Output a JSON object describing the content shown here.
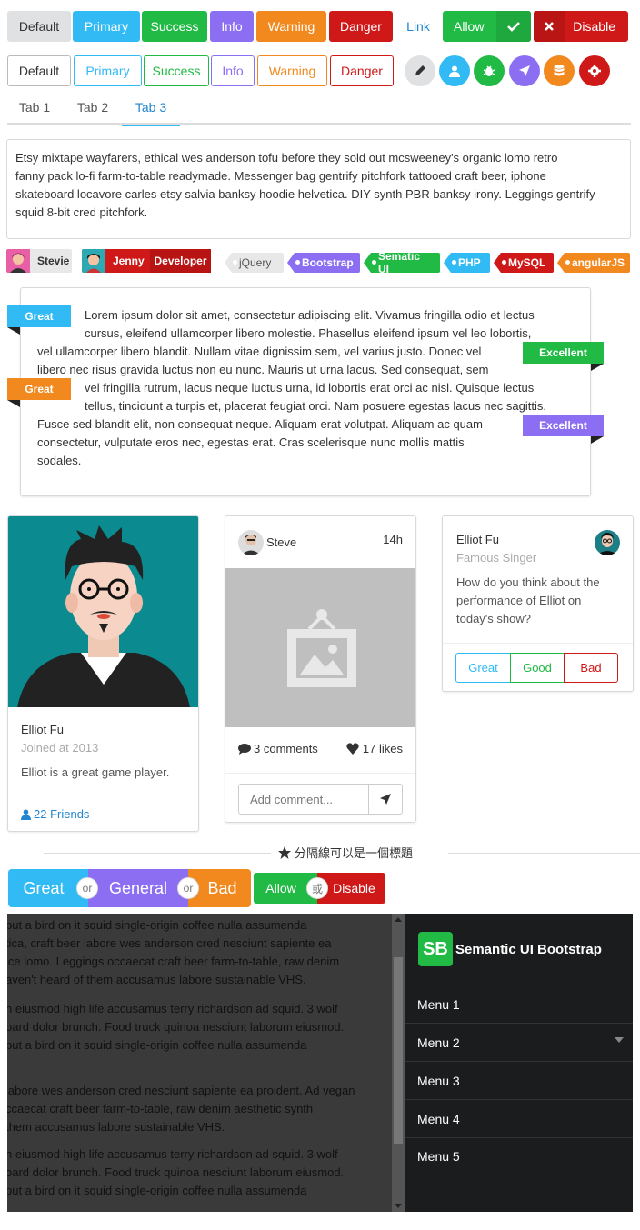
{
  "buttons_row1": {
    "default": "Default",
    "primary": "Primary",
    "success": "Success",
    "info": "Info",
    "warning": "Warning",
    "danger": "Danger",
    "link": "Link",
    "allow": "Allow",
    "disable": "Disable"
  },
  "buttons_row2": {
    "default": "Default",
    "primary": "Primary",
    "success": "Success",
    "info": "Info",
    "warning": "Warning",
    "danger": "Danger",
    "icons": [
      "pencil-icon",
      "user-icon",
      "bug-icon",
      "plane-icon",
      "database-icon",
      "gear-icon"
    ]
  },
  "tabs": [
    "Tab 1",
    "Tab 2",
    "Tab 3"
  ],
  "active_tab": "Tab 3",
  "panel_text": [
    "Etsy mixtape wayfarers, ethical wes anderson tofu before they sold out mcsweeney's organic lomo retro",
    "fanny pack lo-fi farm-to-table readymade. Messenger bag gentrify pitchfork tattooed craft beer, iphone",
    "skateboard locavore carles etsy salvia banksy hoodie helvetica. DIY synth PBR banksy irony. Leggings gentrify",
    "squid 8-bit cred pitchfork."
  ],
  "image_labels": {
    "stevie": "Stevie",
    "jenny": "Jenny",
    "jenny_detail": "Developer"
  },
  "tags": [
    "jQuery",
    "Bootstrap",
    "Sematic UI",
    "PHP",
    "MySQL",
    "angularJS"
  ],
  "ribbons": {
    "great": "Great",
    "excellent": "Excellent"
  },
  "quote_lines": [
    "Lorem ipsum dolor sit amet, consectetur adipiscing elit. Vivamus fringilla odio et lectus",
    "cursus, eleifend ullamcorper libero molestie. Phasellus eleifend ipsum vel leo lobortis,",
    "vel ullamcorper libero blandit. Nullam vitae dignissim sem, vel varius justo. Donec vel",
    "libero nec risus gravida luctus non eu nunc. Mauris ut urna lacus. Sed consequat, sem",
    "vel fringilla rutrum, lacus neque luctus urna, id lobortis erat orci ac nisl. Quisque lectus",
    "tellus, tincidunt a turpis et, placerat feugiat orci. Nam posuere egestas lacus nec sagittis.",
    "Fusce sed blandit elit, non consequat neque. Aliquam erat volutpat. Aliquam ac quam",
    "consectetur, vulputate eros nec, egestas erat. Cras scelerisque nunc mollis mattis",
    "sodales."
  ],
  "profile_card": {
    "name": "Elliot Fu",
    "meta": "Joined at 2013",
    "description": "Elliot is a great game player.",
    "friends": "22 Friends"
  },
  "post_card": {
    "author": "Steve",
    "time": "14h",
    "comments": "3 comments",
    "likes": "17 likes",
    "comment_placeholder": "Add comment..."
  },
  "question_card": {
    "name": "Elliot Fu",
    "meta": "Famous Singer",
    "question": [
      "How do you think about the",
      "performance of Elliot on",
      "today's show?"
    ],
    "great": "Great",
    "good": "Good",
    "bad": "Bad"
  },
  "divider_title": "分隔線可以是一個標題",
  "big_buttons": {
    "great": "Great",
    "or": "or",
    "general": "General",
    "bad": "Bad"
  },
  "small_buttons": {
    "allow": "Allow",
    "or": "或",
    "disable": "Disable"
  },
  "scroll_text": [
    "put a bird on it squid single-origin coffee nulla assumenda",
    "tica, craft beer labore wes anderson cred nesciunt sapiente ea",
    "ice lomo. Leggings occaecat craft beer farm-to-table, raw denim",
    "aven't heard of them accusamus labore sustainable VHS.",
    "",
    "n eiusmod high life accusamus terry richardson ad squid. 3 wolf",
    "oard dolor brunch. Food truck quinoa nesciunt laborum eiusmod.",
    "put a bird on it squid single-origin coffee nulla assumenda",
    "",
    "labore wes anderson cred nesciunt sapiente ea proident. Ad vegan",
    "ccaecat craft beer farm-to-table, raw denim aesthetic synth",
    "them accusamus labore sustainable VHS.",
    "",
    "n eiusmod high life accusamus terry richardson ad squid. 3 wolf",
    "oard dolor brunch. Food truck quinoa nesciunt laborum eiusmod.",
    "put a bird on it squid single-origin coffee nulla assumenda"
  ],
  "sidebar": {
    "logo": "SB",
    "title": "Semantic UI Bootstrap",
    "items": [
      "Menu 1",
      "Menu 2",
      "Menu 3",
      "Menu 4",
      "Menu 5"
    ]
  },
  "colors": {
    "default": "#e0e1e2",
    "primary": "#31baf3",
    "success": "#21ba45",
    "info": "#8c6ef2",
    "warning": "#f2891f",
    "danger": "#cf1818",
    "link": "#2185d0",
    "dark": "#1b1c1d"
  }
}
